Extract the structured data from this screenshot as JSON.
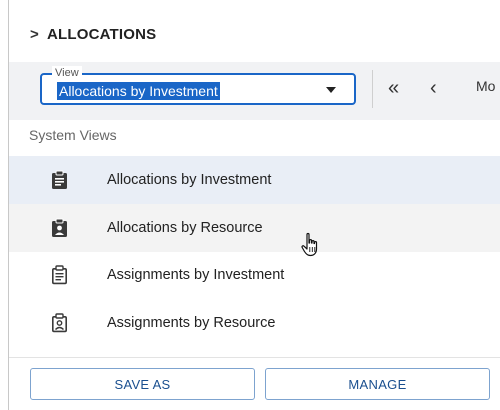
{
  "header": {
    "title": "ALLOCATIONS"
  },
  "toolbar": {
    "view_legend": "View",
    "view_value": "Allocations by Investment",
    "nav_first": "«",
    "nav_prev": "‹",
    "period_label": "Mo"
  },
  "dropdown": {
    "section_label": "System Views",
    "items": [
      {
        "label": "Allocations by Investment",
        "icon": "clipboard-filled-icon",
        "state": "selected"
      },
      {
        "label": "Allocations by Resource",
        "icon": "clipboard-person-filled-icon",
        "state": "hover"
      },
      {
        "label": "Assignments by Investment",
        "icon": "clipboard-outline-icon",
        "state": "normal"
      },
      {
        "label": "Assignments by Resource",
        "icon": "clipboard-person-outline-icon",
        "state": "normal"
      }
    ]
  },
  "footer": {
    "save_as_label": "SAVE AS",
    "manage_label": "MANAGE"
  },
  "colors": {
    "accent": "#1a66c7",
    "selected_row": "#e9eef6",
    "button_border": "#7da3cf",
    "button_text": "#1a4f8f"
  }
}
